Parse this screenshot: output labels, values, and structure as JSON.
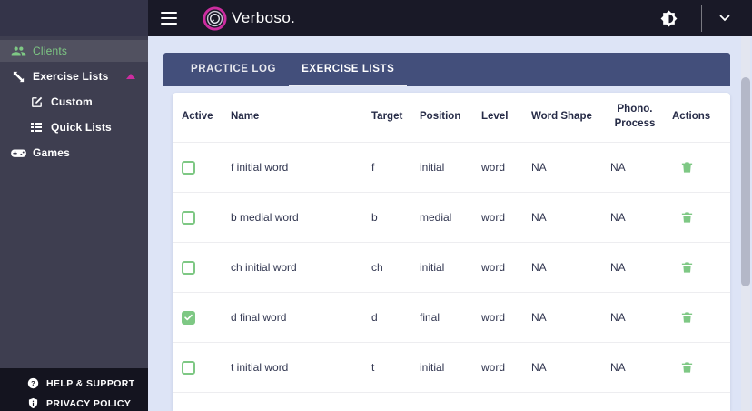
{
  "navbar": {
    "brand": "Verboso."
  },
  "sidebar": {
    "items": [
      {
        "label": "Clients",
        "icon": "people",
        "state": "active",
        "indent": 0
      },
      {
        "label": "Exercise Lists",
        "icon": "arrows-expand",
        "state": "expanded",
        "indent": 0,
        "caret": true
      },
      {
        "label": "Custom",
        "icon": "edit-note",
        "indent": 1
      },
      {
        "label": "Quick Lists",
        "icon": "list",
        "indent": 1
      },
      {
        "label": "Games",
        "icon": "gamepad",
        "indent": 0
      }
    ],
    "footer": [
      {
        "label": "HELP & SUPPORT",
        "icon": "help-circle"
      },
      {
        "label": "PRIVACY POLICY",
        "icon": "shield"
      }
    ]
  },
  "tabs": [
    {
      "label": "PRACTICE LOG",
      "active": false
    },
    {
      "label": "EXERCISE LISTS",
      "active": true
    }
  ],
  "table": {
    "columns": [
      "Active",
      "Name",
      "Target",
      "Position",
      "Level",
      "Word Shape",
      "Phono. Process",
      "Actions"
    ],
    "rows": [
      {
        "active": false,
        "name": "f initial word",
        "target": "f",
        "position": "initial",
        "level": "word",
        "word_shape": "NA",
        "phono_process": "NA"
      },
      {
        "active": false,
        "name": "b medial word",
        "target": "b",
        "position": "medial",
        "level": "word",
        "word_shape": "NA",
        "phono_process": "NA"
      },
      {
        "active": false,
        "name": "ch initial word",
        "target": "ch",
        "position": "initial",
        "level": "word",
        "word_shape": "NA",
        "phono_process": "NA"
      },
      {
        "active": true,
        "name": "d final word",
        "target": "d",
        "position": "final",
        "level": "word",
        "word_shape": "NA",
        "phono_process": "NA"
      },
      {
        "active": false,
        "name": "t initial word",
        "target": "t",
        "position": "initial",
        "level": "word",
        "word_shape": "NA",
        "phono_process": "NA"
      }
    ]
  },
  "colors": {
    "accent_green": "#7ec884",
    "accent_pink": "#cc2da0",
    "navbar_bg": "#191927",
    "sidebar_bg": "#3e3e50",
    "tabbar_bg": "#434f7b",
    "main_bg": "#dde4f6"
  }
}
